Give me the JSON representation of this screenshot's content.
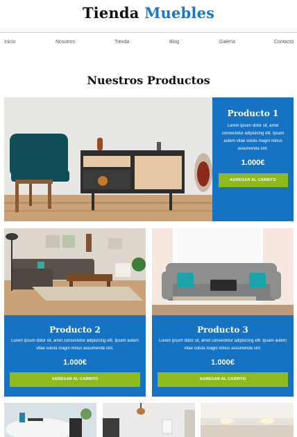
{
  "brand": {
    "part1": "Tienda",
    "part2": "Muebles"
  },
  "nav": {
    "items": [
      "Inicio",
      "Nosotros",
      "Tienda",
      "Blog",
      "Galería",
      "Contacto"
    ]
  },
  "section": {
    "title": "Nuestros Productos"
  },
  "products": [
    {
      "title": "Producto 1",
      "desc": "Lorem ipsum dolor sit, amet consectetur adipisicing elit. Ipsam autem vitae soluta magni minus assumenda sint.",
      "price": "1.000€",
      "button": "AGREGAR AL CARRITO"
    },
    {
      "title": "Producto 2",
      "desc": "Lorem ipsum dolor sit, amet consectetur adipisicing elit. Ipsam autem vitae soluta magni minus assumenda sint.",
      "price": "1.000€",
      "button": "AGREGAR AL CARRITO"
    },
    {
      "title": "Producto 3",
      "desc": "Lorem ipsum dolor sit, amet consectetur adipisicing elit. Ipsam autem vitae soluta magni minus assumenda sint.",
      "price": "1.000€",
      "button": "AGREGAR AL CARRITO"
    }
  ],
  "colors": {
    "accent": "#1673c4",
    "button": "#8dbb1d",
    "brand_accent": "#1a78c2"
  }
}
